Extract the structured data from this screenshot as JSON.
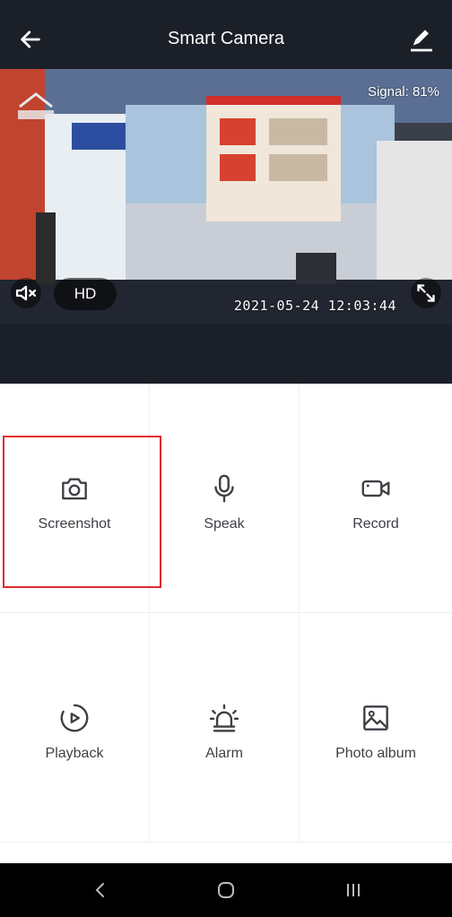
{
  "header": {
    "title": "Smart Camera",
    "back_icon": "arrow-left-icon",
    "edit_icon": "pencil-icon"
  },
  "video": {
    "signal": "Signal: 81%",
    "timestamp": "2021-05-24  12:03:44",
    "quality": "HD",
    "mute_icon": "speaker-muted-icon",
    "fullscreen_icon": "fullscreen-icon"
  },
  "actions": [
    {
      "label": "Screenshot",
      "icon": "camera-icon"
    },
    {
      "label": "Speak",
      "icon": "microphone-icon"
    },
    {
      "label": "Record",
      "icon": "video-camera-icon"
    },
    {
      "label": "Playback",
      "icon": "playback-icon"
    },
    {
      "label": "Alarm",
      "icon": "siren-icon"
    },
    {
      "label": "Photo album",
      "icon": "image-icon"
    }
  ],
  "colors": {
    "header_bg": "#1b1f28",
    "highlight": "#e02a2f",
    "label_text": "#3c3f44"
  },
  "navbar": {
    "back_icon": "nav-back-icon",
    "home_icon": "nav-home-icon",
    "recents_icon": "nav-recents-icon"
  }
}
